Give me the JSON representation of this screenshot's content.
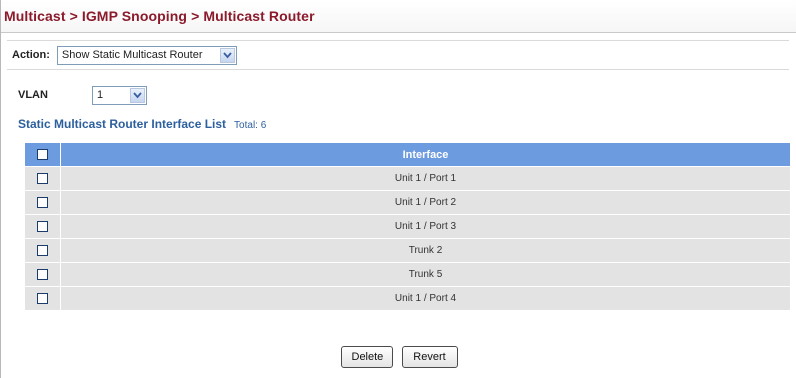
{
  "header": {
    "breadcrumb": "Multicast > IGMP Snooping > Multicast Router"
  },
  "action": {
    "label": "Action:",
    "selected": "Show Static Multicast Router"
  },
  "vlan": {
    "label": "VLAN",
    "selected": "1"
  },
  "list": {
    "title": "Static Multicast Router Interface List",
    "total": "Total: 6",
    "column_header": "Interface",
    "rows": [
      "Unit 1 / Port 1",
      "Unit 1 / Port 2",
      "Unit 1 / Port 3",
      "Trunk 2",
      "Trunk 5",
      "Unit 1 / Port 4"
    ]
  },
  "buttons": {
    "delete": "Delete",
    "revert": "Revert"
  },
  "colors": {
    "title": "#8b1a2b",
    "table_header": "#6d9be0",
    "row_bg": "#e3e3e3",
    "list_title": "#2c5f9e"
  },
  "icons": {
    "select_arrow": "chevron-down-icon",
    "checkbox": "checkbox-unchecked"
  }
}
